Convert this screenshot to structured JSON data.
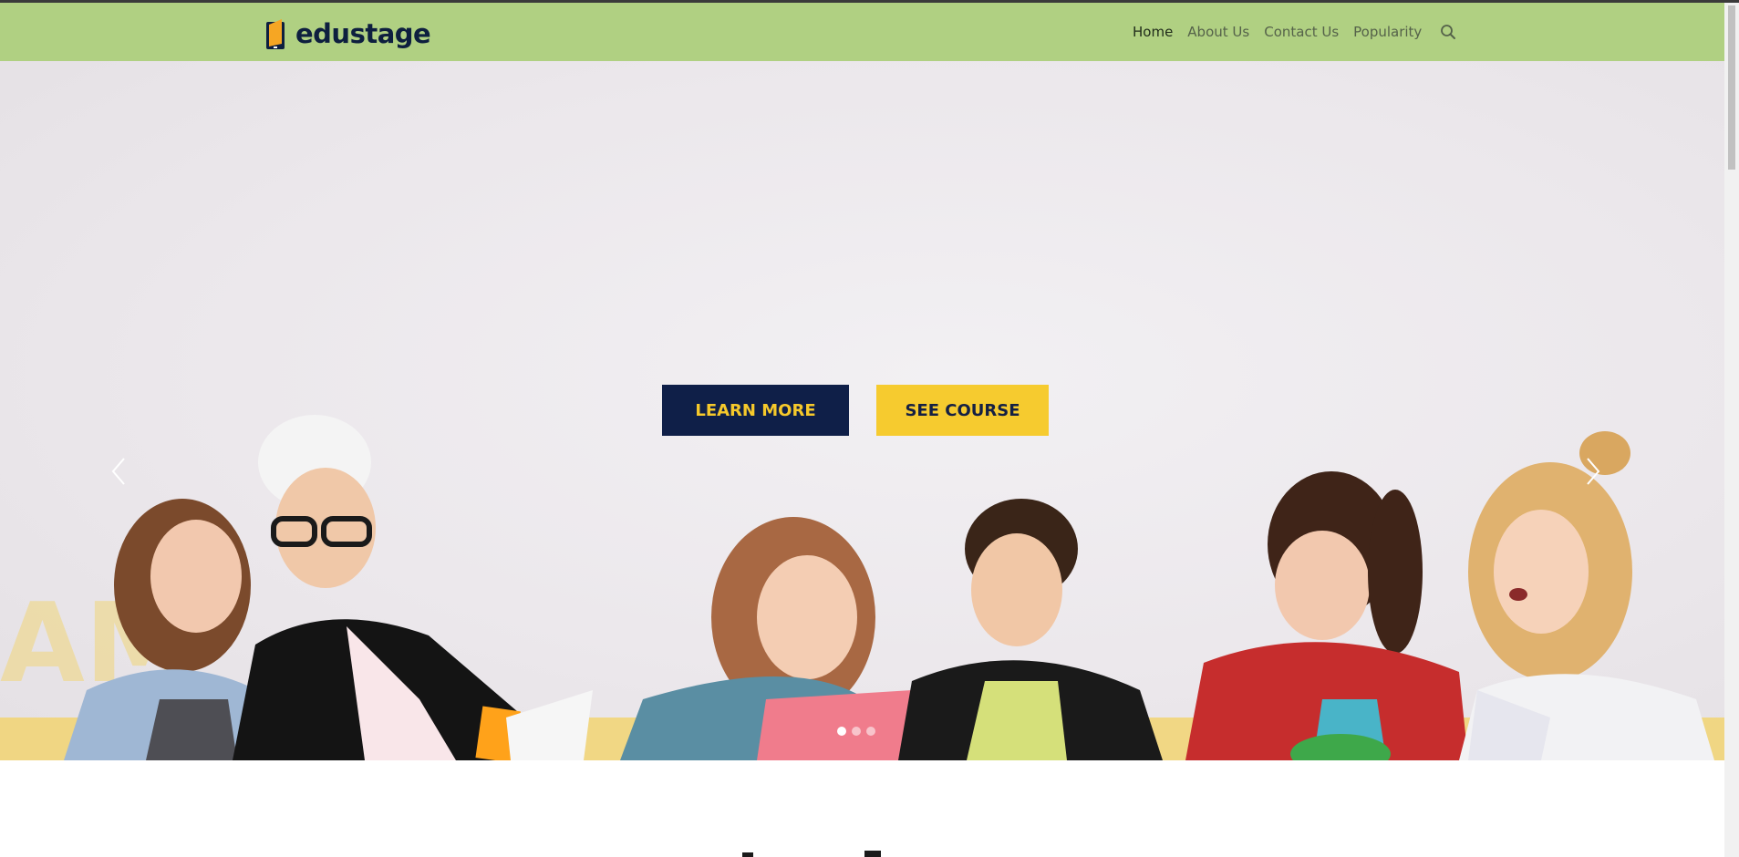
{
  "brand": {
    "name": "edustage"
  },
  "nav": {
    "items": [
      {
        "label": "Home",
        "active": true
      },
      {
        "label": "About Us",
        "active": false
      },
      {
        "label": "Contact Us",
        "active": false
      },
      {
        "label": "Popularity",
        "active": false
      }
    ],
    "search_icon": "search-icon"
  },
  "hero": {
    "learn_more_label": "LEARN MORE",
    "see_course_label": "SEE COURSE",
    "prev_icon": "chevron-left-icon",
    "next_icon": "chevron-right-icon",
    "slides_total": 3,
    "active_slide": 1
  },
  "colors": {
    "navbar_bg": "#b0d082",
    "brand_text": "#0e1f3f",
    "learn_more_bg": "#0f1f48",
    "learn_more_text": "#f6c92b",
    "see_course_bg": "#f6cb2f",
    "see_course_text": "#152043"
  }
}
